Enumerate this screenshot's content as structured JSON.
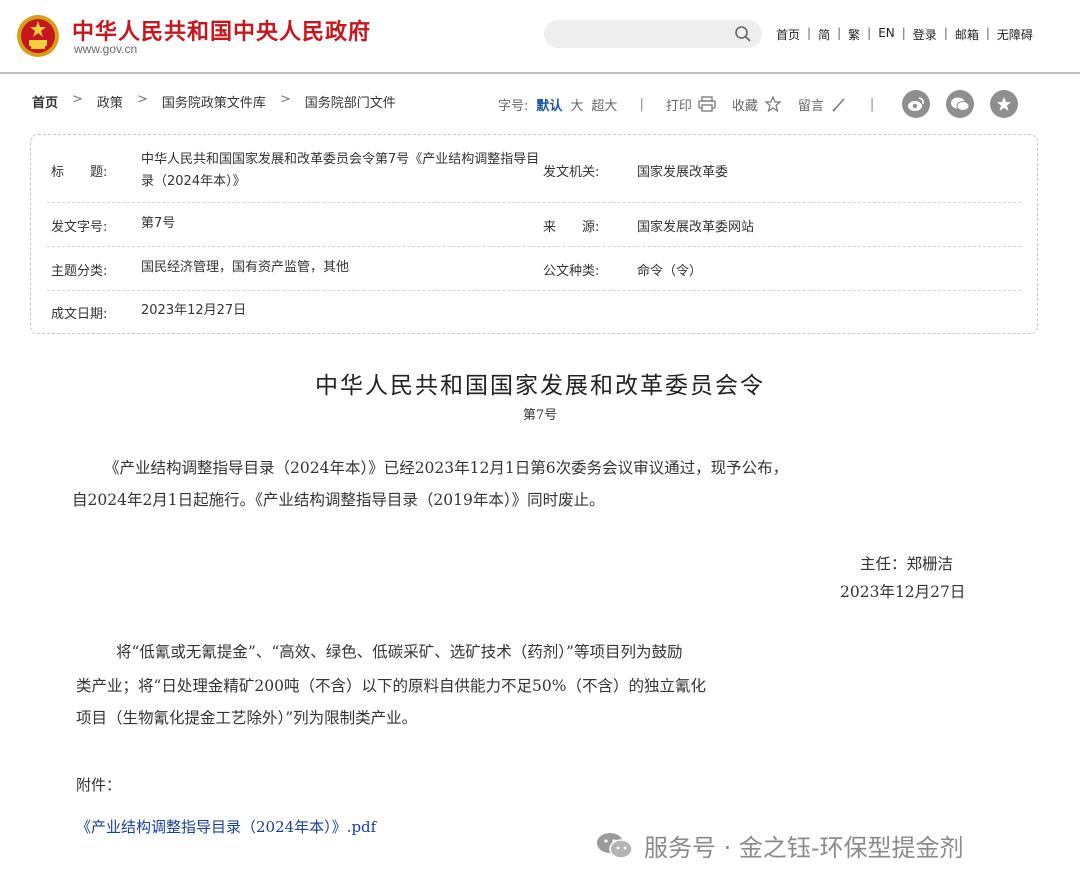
{
  "header": {
    "site_title": "中华人民共和国中央人民政府",
    "site_domain": "www.gov.cn",
    "search_placeholder": "",
    "nav": [
      "首页",
      "简",
      "繁",
      "EN",
      "登录",
      "邮箱",
      "无障碍"
    ]
  },
  "breadcrumb": {
    "items": [
      "首页",
      "政策",
      "国务院政策文件库",
      "国务院部门文件"
    ]
  },
  "tools": {
    "font_label": "字号:",
    "font_default": "默认",
    "font_large": "大",
    "font_xlarge": "超大",
    "print": "打印",
    "favorite": "收藏",
    "comment": "留言"
  },
  "meta": {
    "title_label": "标　　题:",
    "title_value": "中华人民共和国国家发展和改革委员会令第7号《产业结构调整指导目录（2024年本）》",
    "issuer_label": "发文机关:",
    "issuer_value": "国家发展改革委",
    "doc_no_label": "发文字号:",
    "doc_no_value": "第7号",
    "source_label": "来　　源:",
    "source_value": "国家发展改革委网站",
    "topic_label": "主题分类:",
    "topic_value": "国民经济管理，国有资产监管，其他",
    "doc_type_label": "公文种类:",
    "doc_type_value": "命令（令）",
    "date_label": "成文日期:",
    "date_value": "2023年12月27日"
  },
  "body": {
    "title": "中华人民共和国国家发展和改革委员会令",
    "number": "第7号",
    "para1_line1": "《产业结构调整指导目录（2024年本）》已经2023年12月1日第6次委务会议审议通过，现予公布，",
    "para1_line2": "自2024年2月1日起施行。《产业结构调整指导目录（2019年本）》同时废止。",
    "signer": "主任：郑栅洁",
    "sign_date": "2023年12月27日",
    "para2_line1": "将“低氰或无氰提金”、“高效、绿色、低碳采矿、选矿技术（药剂）”等项目列为鼓励",
    "para2_line2": "类产业；将“日处理金精矿200吨（不含）以下的原料自供能力不足50%（不含）的独立氰化",
    "para2_line3": "项目（生物氰化提金工艺除外）”列为限制类产业。",
    "attach_label": "附件：",
    "attach_link": "《产业结构调整指导目录（2024年本）》.pdf"
  },
  "watermark": {
    "text": "服务号 · 金之钰-环保型提金剂"
  },
  "colors": {
    "brand_red": "#c8161d",
    "link_blue": "#1a3e9c",
    "active_blue": "#1a56a6"
  }
}
